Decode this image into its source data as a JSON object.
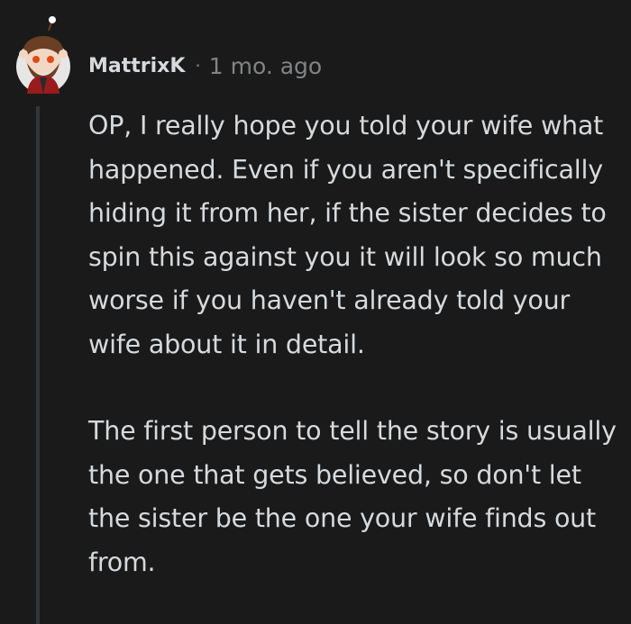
{
  "comment": {
    "author": "MattrixK",
    "separator": "·",
    "timestamp": "1 mo. ago",
    "avatar_icon": "snoo-avatar-icon",
    "paragraphs": [
      "OP, I really hope you told your wife what happened. Even if you aren't specifically hiding it from her, if the sister decides to spin this against you it will look so much worse if you haven't already told your wife about it in detail.",
      "The first person to tell the story is usually the one that gets believed, so don't let the sister be the one your wife finds out from."
    ]
  },
  "colors": {
    "background": "#1a1a1b",
    "text": "#d7dadc",
    "meta": "#818384",
    "thread_line": "#343536",
    "avatar_bg": "#e6e6e6",
    "avatar_hair": "#6b3f23",
    "avatar_shirt": "#9a1b1b"
  }
}
